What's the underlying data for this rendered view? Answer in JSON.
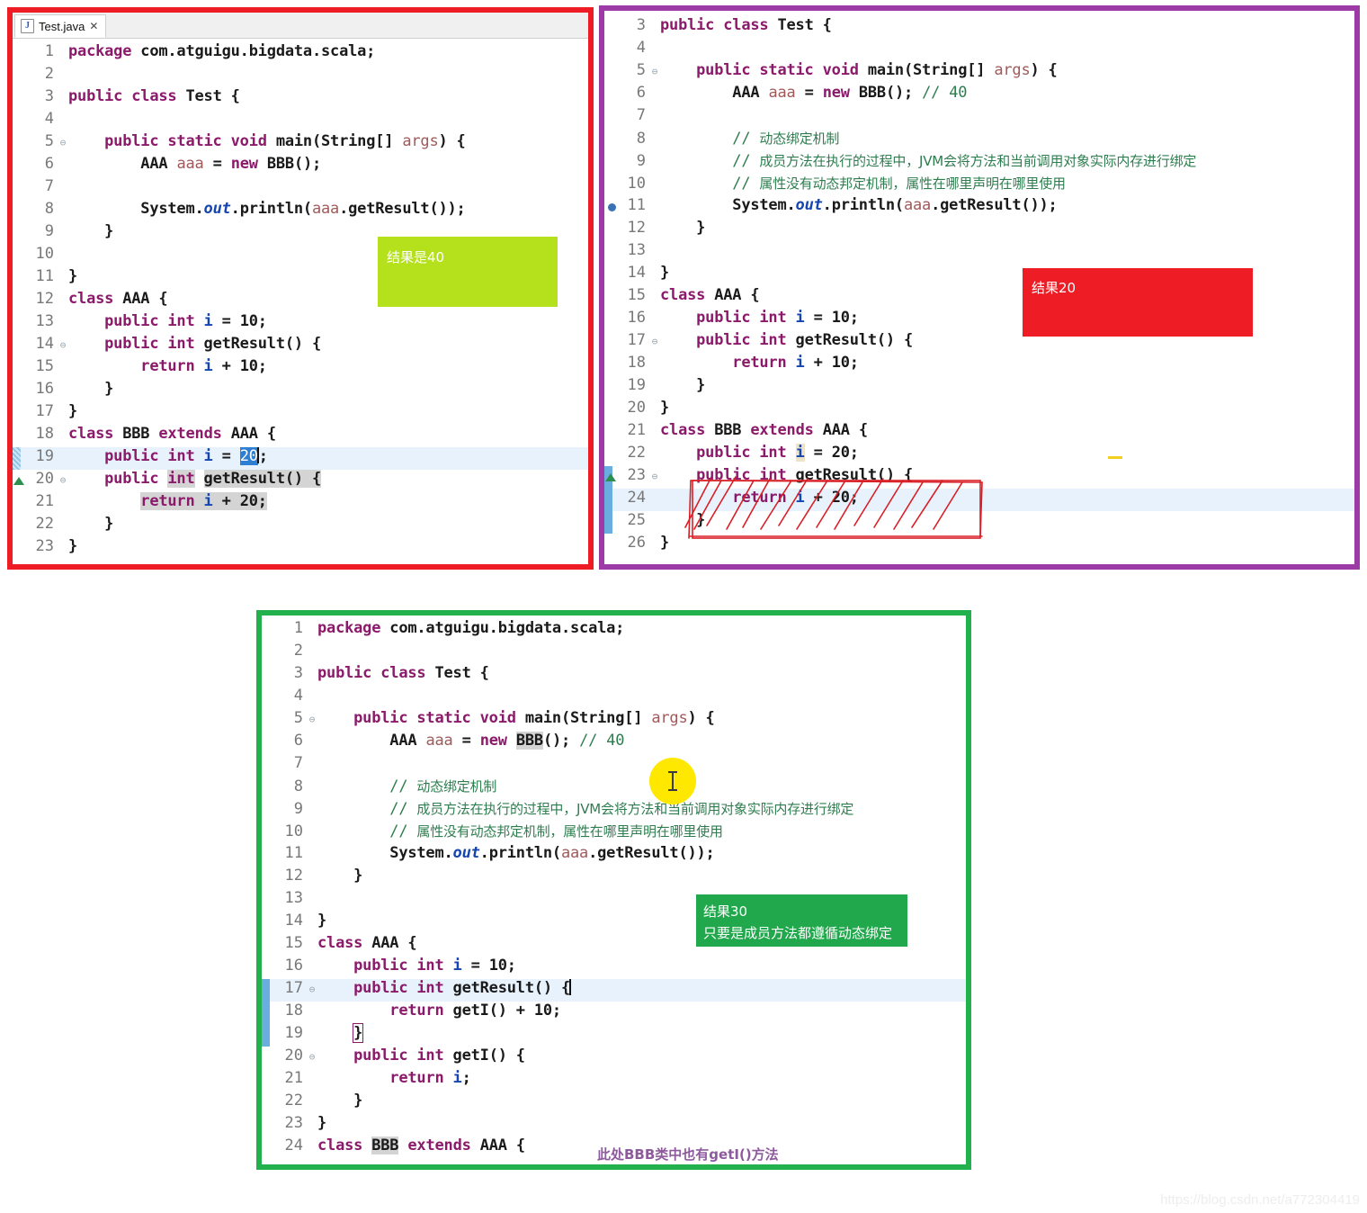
{
  "watermark": "https://blog.csdn.net/a772304419",
  "panels": [
    {
      "id": "panel-red",
      "border_color": "#ee1c25",
      "tab": {
        "label": "Test.java",
        "icon": "java-file-icon",
        "icon_letter": "J",
        "close": "✕"
      },
      "lines": [
        {
          "n": "1",
          "text": "package com.atguigu.bigdata.scala;"
        },
        {
          "n": "2",
          "text": ""
        },
        {
          "n": "3",
          "text": "public class Test {"
        },
        {
          "n": "4",
          "text": ""
        },
        {
          "n": "5",
          "text": "    public static void main(String[] args) {"
        },
        {
          "n": "6",
          "text": "        AAA aaa = new BBB();"
        },
        {
          "n": "7",
          "text": ""
        },
        {
          "n": "8",
          "text": "        System.out.println(aaa.getResult());"
        },
        {
          "n": "9",
          "text": "    }"
        },
        {
          "n": "10",
          "text": ""
        },
        {
          "n": "11",
          "text": "}"
        },
        {
          "n": "12",
          "text": "class AAA {"
        },
        {
          "n": "13",
          "text": "    public int i = 10;"
        },
        {
          "n": "14",
          "text": "    public int getResult() {"
        },
        {
          "n": "15",
          "text": "        return i + 10;"
        },
        {
          "n": "16",
          "text": "    }"
        },
        {
          "n": "17",
          "text": "}"
        },
        {
          "n": "18",
          "text": "class BBB extends AAA {"
        },
        {
          "n": "19",
          "text": "    public int i = 20;"
        },
        {
          "n": "20",
          "text": "    public int getResult() {"
        },
        {
          "n": "21",
          "text": "        return i + 20;"
        },
        {
          "n": "22",
          "text": "    }"
        },
        {
          "n": "23",
          "text": "}"
        }
      ],
      "callout": {
        "color": "#b5e01c",
        "text": "结果是40"
      }
    },
    {
      "id": "panel-purple",
      "border_color": "#9c3aa6",
      "lines": [
        {
          "n": "3",
          "text": "public class Test {"
        },
        {
          "n": "4",
          "text": ""
        },
        {
          "n": "5",
          "text": "    public static void main(String[] args) {"
        },
        {
          "n": "6",
          "text": "        AAA aaa = new BBB(); // 40"
        },
        {
          "n": "7",
          "text": ""
        },
        {
          "n": "8",
          "text": "        // 动态绑定机制"
        },
        {
          "n": "9",
          "text": "        // 成员方法在执行的过程中，JVM会将方法和当前调用对象实际内存进行绑定"
        },
        {
          "n": "10",
          "text": "        // 属性没有动态邦定机制，属性在哪里声明在哪里使用"
        },
        {
          "n": "11",
          "text": "        System.out.println(aaa.getResult());"
        },
        {
          "n": "12",
          "text": "    }"
        },
        {
          "n": "13",
          "text": ""
        },
        {
          "n": "14",
          "text": "}"
        },
        {
          "n": "15",
          "text": "class AAA {"
        },
        {
          "n": "16",
          "text": "    public int i = 10;"
        },
        {
          "n": "17",
          "text": "    public int getResult() {"
        },
        {
          "n": "18",
          "text": "        return i + 10;"
        },
        {
          "n": "19",
          "text": "    }"
        },
        {
          "n": "20",
          "text": "}"
        },
        {
          "n": "21",
          "text": "class BBB extends AAA {"
        },
        {
          "n": "22",
          "text": "    public int i = 20;"
        },
        {
          "n": "23",
          "text": "    public int getResult() {"
        },
        {
          "n": "24",
          "text": "        return i + 20;"
        },
        {
          "n": "25",
          "text": "    }"
        },
        {
          "n": "26",
          "text": "}"
        }
      ],
      "callout": {
        "color": "#ee1c25",
        "text": "结果20"
      },
      "strikeout": {
        "color": "#d81f26",
        "covers": "lines 23-25 getResult override"
      }
    },
    {
      "id": "panel-green",
      "border_color": "#22b14c",
      "lines": [
        {
          "n": "1",
          "text": "package com.atguigu.bigdata.scala;"
        },
        {
          "n": "2",
          "text": ""
        },
        {
          "n": "3",
          "text": "public class Test {"
        },
        {
          "n": "4",
          "text": ""
        },
        {
          "n": "5",
          "text": "    public static void main(String[] args) {"
        },
        {
          "n": "6",
          "text": "        AAA aaa = new BBB(); // 40"
        },
        {
          "n": "7",
          "text": ""
        },
        {
          "n": "8",
          "text": "        // 动态绑定机制"
        },
        {
          "n": "9",
          "text": "        // 成员方法在执行的过程中，JVM会将方法和当前调用对象实际内存进行绑定"
        },
        {
          "n": "10",
          "text": "        // 属性没有动态邦定机制，属性在哪里声明在哪里使用"
        },
        {
          "n": "11",
          "text": "        System.out.println(aaa.getResult());"
        },
        {
          "n": "12",
          "text": "    }"
        },
        {
          "n": "13",
          "text": ""
        },
        {
          "n": "14",
          "text": "}"
        },
        {
          "n": "15",
          "text": "class AAA {"
        },
        {
          "n": "16",
          "text": "    public int i = 10;"
        },
        {
          "n": "17",
          "text": "    public int getResult() {"
        },
        {
          "n": "18",
          "text": "        return getI() + 10;"
        },
        {
          "n": "19",
          "text": "    }"
        },
        {
          "n": "20",
          "text": "    public int getI() {"
        },
        {
          "n": "21",
          "text": "        return i;"
        },
        {
          "n": "22",
          "text": "    }"
        },
        {
          "n": "23",
          "text": "}"
        },
        {
          "n": "24",
          "text": "class BBB extends AAA {"
        }
      ],
      "callout": {
        "color": "#22a84c",
        "line1": "结果30",
        "line2": "只要是成员方法都遵循动态绑定"
      },
      "note": {
        "color": "#8e5a9e",
        "text": "此处BBB类中也有getI()方法"
      },
      "cursor": {
        "icon": "text-ibeam-cursor",
        "puck_color": "#ffe800"
      }
    }
  ]
}
